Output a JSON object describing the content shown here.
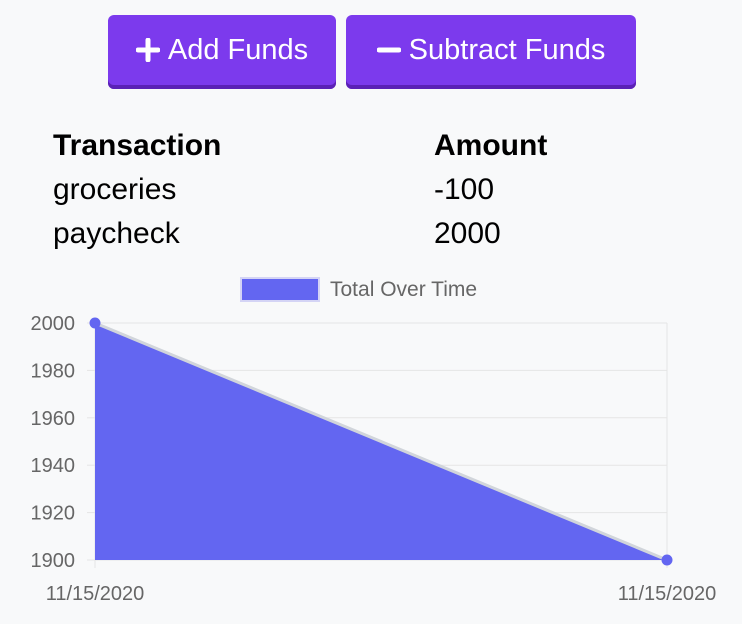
{
  "buttons": {
    "add_label": "Add Funds",
    "subtract_label": "Subtract Funds"
  },
  "table": {
    "headers": [
      "Transaction",
      "Amount"
    ],
    "rows": [
      {
        "name": "groceries",
        "amount": "-100"
      },
      {
        "name": "paycheck",
        "amount": "2000"
      }
    ]
  },
  "colors": {
    "accent": "#7c3aed",
    "area_fill": "#6366f1",
    "line": "#d1d5db"
  },
  "chart_data": {
    "type": "area",
    "title": "",
    "xlabel": "",
    "ylabel": "",
    "x": [
      "11/15/2020",
      "11/15/2020"
    ],
    "series": [
      {
        "name": "Total Over Time",
        "values": [
          2000,
          1900
        ]
      }
    ],
    "ylim": [
      1900,
      2000
    ],
    "yticks": [
      1900,
      1920,
      1940,
      1960,
      1980,
      2000
    ],
    "grid": true,
    "legend": "top-center"
  }
}
